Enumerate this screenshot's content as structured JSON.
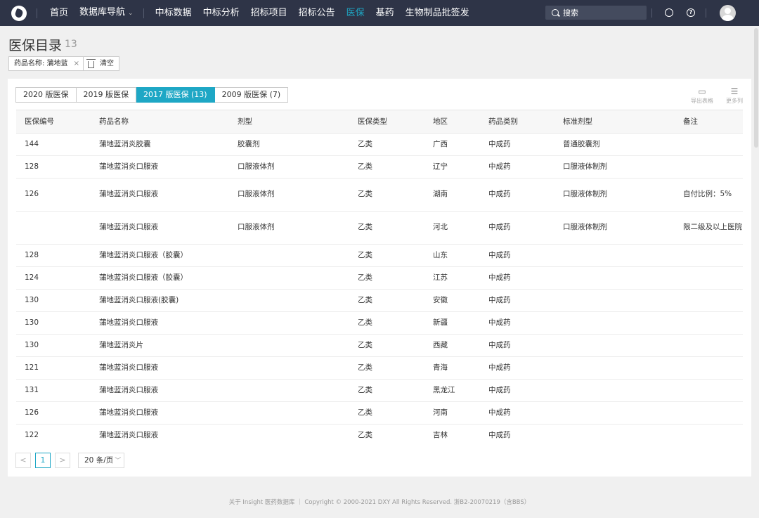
{
  "topbar": {
    "nav": [
      {
        "label": "首页",
        "active": false
      },
      {
        "label": "数据库导航",
        "active": false,
        "dropdown": true
      },
      {
        "label": "中标数据",
        "active": false
      },
      {
        "label": "中标分析",
        "active": false
      },
      {
        "label": "招标项目",
        "active": false
      },
      {
        "label": "招标公告",
        "active": false
      },
      {
        "label": "医保",
        "active": true
      },
      {
        "label": "基药",
        "active": false
      },
      {
        "label": "生物制品批签发",
        "active": false
      }
    ],
    "search_placeholder": "搜索",
    "accent_color": "#1ea7c5"
  },
  "header": {
    "title": "医保目录",
    "count": "13",
    "filter_tag": "药品名称: 蒲地蓝",
    "clear_label": "清空"
  },
  "tabs": [
    {
      "label": "2020 版医保",
      "active": false
    },
    {
      "label": "2019 版医保",
      "active": false
    },
    {
      "label": "2017 版医保 (13)",
      "active": true
    },
    {
      "label": "2009 版医保 (7)",
      "active": false
    }
  ],
  "tools": {
    "export_label": "导出表格",
    "columns_label": "更多列"
  },
  "table": {
    "headers": [
      "医保编号",
      "药品名称",
      "剂型",
      "医保类型",
      "地区",
      "药品类别",
      "标准剂型",
      "备注"
    ],
    "rows": [
      [
        "144",
        "蒲地蓝消炎胶囊",
        "胶囊剂",
        "乙类",
        "广西",
        "中成药",
        "普通胶囊剂",
        ""
      ],
      [
        "128",
        "蒲地蓝消炎口服液",
        "口服液体剂",
        "乙类",
        "辽宁",
        "中成药",
        "口服液体制剂",
        ""
      ],
      [
        "126",
        "蒲地蓝消炎口服液",
        "口服液体剂",
        "乙类",
        "湖南",
        "中成药",
        "口服液体制剂",
        "自付比例：5%"
      ],
      [
        "",
        "蒲地蓝消炎口服液",
        "口服液体剂",
        "乙类",
        "河北",
        "中成药",
        "口服液体制剂",
        "限二级及以上医院"
      ],
      [
        "128",
        "蒲地蓝消炎口服液（胶囊）",
        "",
        "乙类",
        "山东",
        "中成药",
        "",
        ""
      ],
      [
        "124",
        "蒲地蓝消炎口服液（胶囊）",
        "",
        "乙类",
        "江苏",
        "中成药",
        "",
        ""
      ],
      [
        "130",
        "蒲地蓝消炎口服液(胶囊)",
        "",
        "乙类",
        "安徽",
        "中成药",
        "",
        ""
      ],
      [
        "130",
        "蒲地蓝消炎口服液",
        "",
        "乙类",
        "新疆",
        "中成药",
        "",
        ""
      ],
      [
        "130",
        "蒲地蓝消炎片",
        "",
        "乙类",
        "西藏",
        "中成药",
        "",
        ""
      ],
      [
        "121",
        "蒲地蓝消炎口服液",
        "",
        "乙类",
        "青海",
        "中成药",
        "",
        ""
      ],
      [
        "131",
        "蒲地蓝消炎口服液",
        "",
        "乙类",
        "黑龙江",
        "中成药",
        "",
        ""
      ],
      [
        "126",
        "蒲地蓝消炎口服液",
        "",
        "乙类",
        "河南",
        "中成药",
        "",
        ""
      ],
      [
        "122",
        "蒲地蓝消炎口服液",
        "",
        "乙类",
        "吉林",
        "中成药",
        "",
        ""
      ],
      [
        "",
        "",
        "",
        "",
        "",
        "",
        "",
        ""
      ]
    ]
  },
  "pagination": {
    "prev": "<",
    "current_page": "1",
    "next": ">",
    "page_size": "20 条/页"
  },
  "footer": "关于 Insight 医药数据库 ｜ Copyright © 2000-2021 DXY All Rights Reserved. 浙B2-20070219（含BBS）"
}
